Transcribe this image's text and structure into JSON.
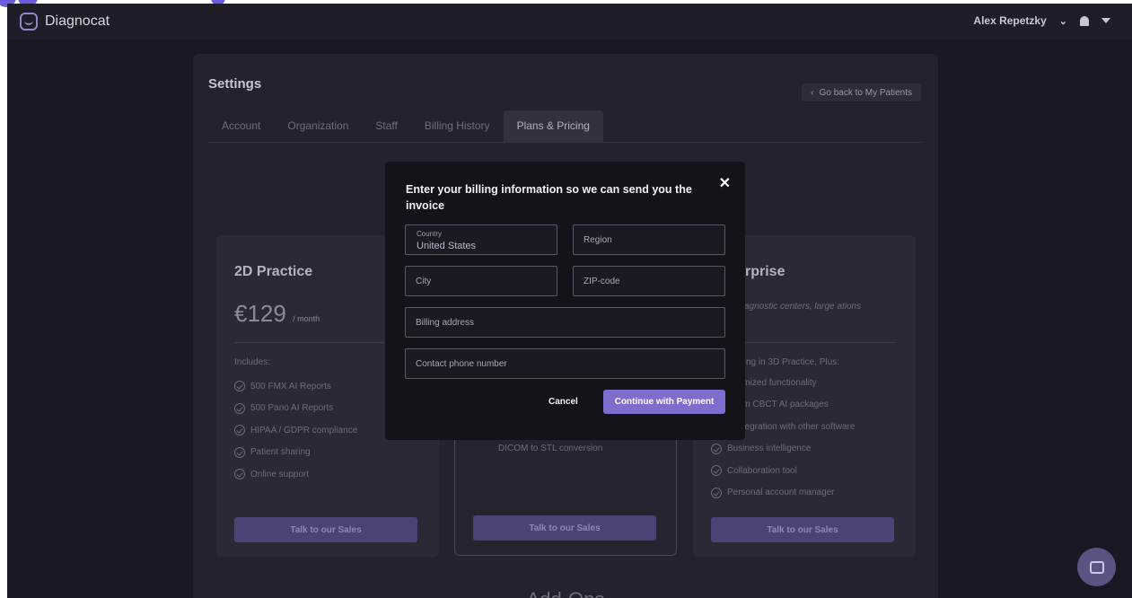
{
  "app": {
    "name": "Diagnocat"
  },
  "user": {
    "name": "Alex Repetzky"
  },
  "settings": {
    "title": "Settings",
    "back_label": "Go back to My Patients",
    "tabs": [
      "Account",
      "Organization",
      "Staff",
      "Billing History",
      "Plans & Pricing"
    ],
    "active_tab": "Plans & Pricing"
  },
  "plans": [
    {
      "name": "2D Practice",
      "price": "€129",
      "period": "/ month",
      "includes_label": "Includes:",
      "features": [
        "500 FMX AI Reports",
        "500 Pano AI Reports",
        "HIPAA / GDPR compliance",
        "Patient sharing",
        "Online support"
      ],
      "cta": "Talk to our Sales"
    },
    {
      "features": [
        "DICOM to STL conversion"
      ],
      "cta": "Talk to our Sales"
    },
    {
      "name": "rprise",
      "description": "agnostic centers, large ations",
      "includes_label": "ng in 3D Practice, Plus:",
      "features": [
        "tomized functionality",
        "tom CBCT AI packages",
        "integration with other software",
        "Business intelligence",
        "Collaboration tool",
        "Personal account manager"
      ],
      "cta": "Talk to our Sales"
    }
  ],
  "addons_heading": "Add-Ons",
  "modal": {
    "title": "Enter your billing information so we can send you the invoice",
    "country_label": "Country",
    "country_value": "United States",
    "region_placeholder": "Region",
    "city_placeholder": "City",
    "zip_placeholder": "ZIP-code",
    "address_placeholder": "Billing address",
    "phone_placeholder": "Contact phone number",
    "cancel_label": "Cancel",
    "submit_label": "Continue with Payment"
  },
  "colors": {
    "primary": "#7f6dcd",
    "background": "#1a1822",
    "modal": "#14131a"
  },
  "icons": [
    "logo-icon",
    "chevron-down-icon",
    "bell-icon",
    "caret-down-icon",
    "back-arrow-icon",
    "close-icon",
    "check-circle-icon",
    "chat-icon"
  ]
}
